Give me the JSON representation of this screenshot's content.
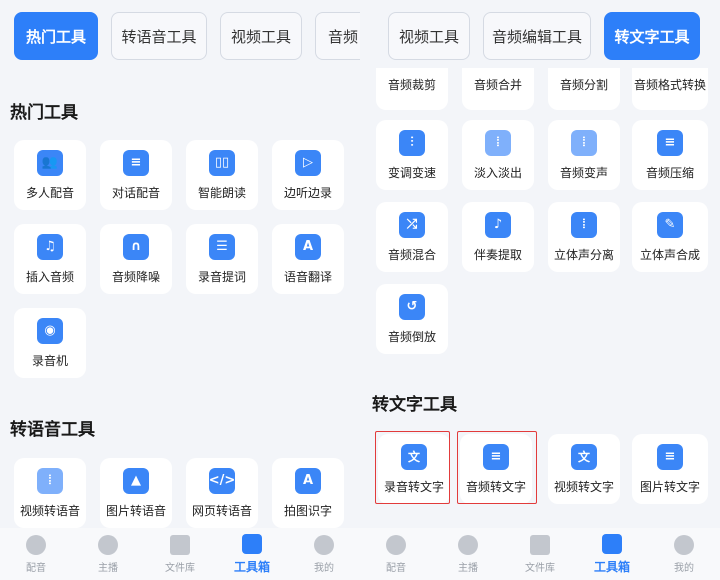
{
  "left": {
    "tabs": [
      "热门工具",
      "转语音工具",
      "视频工具",
      "音频"
    ],
    "hot_title": "热门工具",
    "hot_tools": [
      "多人配音",
      "对话配音",
      "智能朗读",
      "边听边录",
      "插入音频",
      "音频降噪",
      "录音提词",
      "语音翻译",
      "录音机"
    ],
    "speech_title": "转语音工具",
    "speech_tools": [
      "视频转语音",
      "图片转语音",
      "网页转语音",
      "拍图识字"
    ]
  },
  "right": {
    "tabs": [
      "视频工具",
      "音频编辑工具",
      "转文字工具"
    ],
    "top_cut_tools": [
      "音频裁剪",
      "音频合并",
      "音频分割",
      "音频格式转换"
    ],
    "audio_tools": [
      "变调变速",
      "淡入淡出",
      "音频变声",
      "音频压缩",
      "音频混合",
      "伴奏提取",
      "立体声分离",
      "立体声合成",
      "音频倒放"
    ],
    "text_title": "转文字工具",
    "text_tools": [
      "录音转文字",
      "音频转文字",
      "视频转文字",
      "图片转文字"
    ]
  },
  "nav": [
    "配音",
    "主播",
    "文件库",
    "工具箱",
    "我的"
  ],
  "colors": {
    "accent": "#2d7ff9",
    "highlight": "#e23b3b"
  }
}
